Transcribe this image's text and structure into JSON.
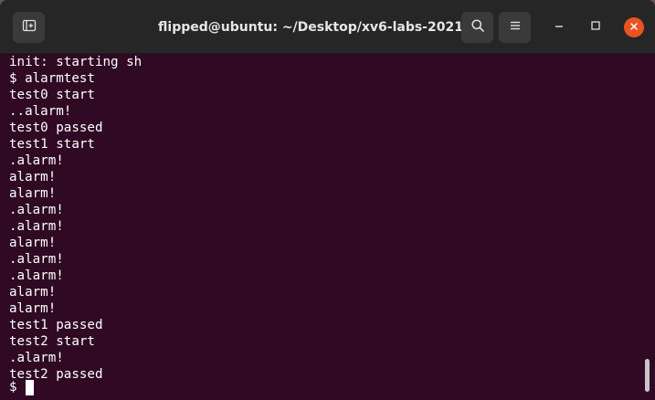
{
  "window": {
    "title": "flipped@ubuntu: ~/Desktop/xv6-labs-2021"
  },
  "header": {
    "new_tab_icon": "new-tab-icon",
    "search_icon": "search-icon",
    "menu_icon": "hamburger-menu-icon",
    "minimize_icon": "minimize-icon",
    "maximize_icon": "maximize-icon",
    "close_icon": "close-icon",
    "close_color": "#e95420"
  },
  "terminal": {
    "background": "#300a24",
    "lines": [
      "init: starting sh",
      "$ alarmtest",
      "test0 start",
      "..alarm!",
      "test0 passed",
      "test1 start",
      ".alarm!",
      "alarm!",
      "alarm!",
      ".alarm!",
      ".alarm!",
      "alarm!",
      ".alarm!",
      ".alarm!",
      "alarm!",
      "alarm!",
      "test1 passed",
      "test2 start",
      ".alarm!",
      "test2 passed"
    ],
    "prompt": "$"
  }
}
